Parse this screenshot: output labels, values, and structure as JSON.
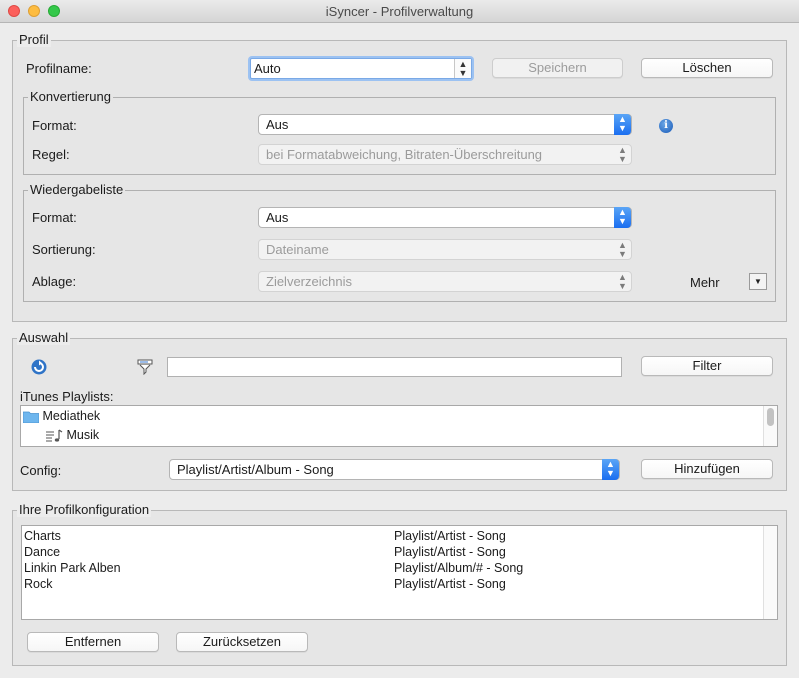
{
  "window": {
    "title": "iSyncer - Profilverwaltung"
  },
  "profil": {
    "legend": "Profil",
    "name_label": "Profilname:",
    "name_value": "Auto",
    "save_label": "Speichern",
    "delete_label": "Löschen"
  },
  "konvertierung": {
    "legend": "Konvertierung",
    "format_label": "Format:",
    "format_value": "Aus",
    "regel_label": "Regel:",
    "regel_value": "bei Formatabweichung, Bitraten-Überschreitung"
  },
  "wiedergabeliste": {
    "legend": "Wiedergabeliste",
    "format_label": "Format:",
    "format_value": "Aus",
    "sortierung_label": "Sortierung:",
    "sortierung_value": "Dateiname",
    "ablage_label": "Ablage:",
    "ablage_value": "Zielverzeichnis",
    "mehr_label": "Mehr"
  },
  "auswahl": {
    "legend": "Auswahl",
    "filter_value": "",
    "filter_button": "Filter",
    "playlists_label": "iTunes Playlists:",
    "playlists": [
      {
        "label": "Mediathek",
        "icon": "folder-icon"
      },
      {
        "label": "Musik",
        "icon": "music-playlist-icon"
      }
    ],
    "config_label": "Config:",
    "config_value": "Playlist/Artist/Album - Song",
    "add_button": "Hinzufügen"
  },
  "profilkonfiguration": {
    "legend": "Ihre Profilkonfiguration",
    "rows": [
      {
        "name": "Charts",
        "pattern": "Playlist/Artist - Song"
      },
      {
        "name": "Dance",
        "pattern": "Playlist/Artist - Song"
      },
      {
        "name": "Linkin Park Alben",
        "pattern": "Playlist/Album/# - Song"
      },
      {
        "name": "Rock",
        "pattern": "Playlist/Artist - Song"
      }
    ],
    "remove_button": "Entfernen",
    "reset_button": "Zurücksetzen"
  },
  "colors": {
    "accent": "#1a6ef0",
    "background": "#ececec"
  }
}
